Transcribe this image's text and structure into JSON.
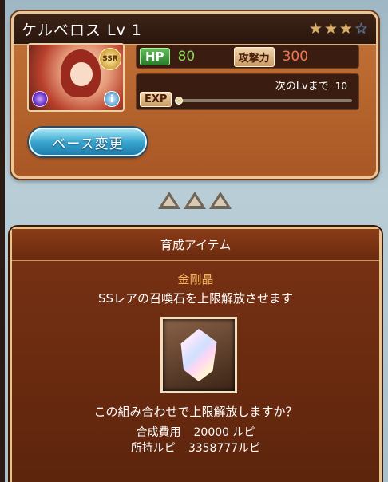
{
  "summon": {
    "title": "ケルベロス Lv 1",
    "stars": [
      "filled",
      "filled",
      "filled",
      "empty"
    ],
    "rarity_badge": "SSR",
    "info_icon_glyph": "i",
    "hp_label": "HP",
    "hp_value": "80",
    "atk_label": "攻撃力",
    "atk_value": "300",
    "next_lv_label": "次のLvまで",
    "next_lv_value": "10",
    "exp_label": "EXP",
    "exp_progress": 0.0,
    "base_button_label": "ベース変更"
  },
  "item_panel": {
    "header": "育成アイテム",
    "item_name": "金剛晶",
    "item_description": "SSレアの召喚石を上限解放させます",
    "confirm_question": "この組み合わせで上限解放しますか？",
    "cost_label": "合成費用",
    "cost_value": "20000 ルピ",
    "owned_label": "所持ルピ",
    "owned_value": "3358777ルピ"
  },
  "colors": {
    "hp_value": "#8cd75d",
    "atk_value": "#f07a4c",
    "item_name": "#f4b25a",
    "star_filled": "#d9b065",
    "star_empty": "#2c6fb0"
  }
}
